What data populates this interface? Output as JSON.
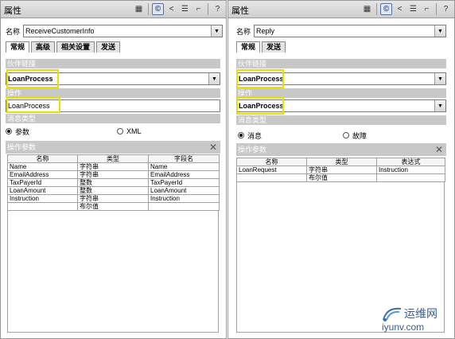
{
  "left_panel": {
    "title": "属性",
    "name_label": "名称",
    "name_value": "ReceiveCustomerInfo",
    "tabs": [
      "常规",
      "高级",
      "相关设置",
      "发送"
    ],
    "partner_link_label": "伙伴链接",
    "partner_link_value": "LoanProcess",
    "operation_label": "操作",
    "operation_value": "LoanProcess",
    "message_type_label": "消息类型",
    "radio_params": "参数",
    "radio_xml": "XML",
    "params_label": "操作参数",
    "columns": [
      "名称",
      "类型",
      "字段名"
    ],
    "rows": [
      [
        "Name",
        "字符串",
        "Name"
      ],
      [
        "EmailAddress",
        "字符串",
        "EmailAddress"
      ],
      [
        "TaxPayerId",
        "整数",
        "TaxPayerId"
      ],
      [
        "LoanAmount",
        "整数",
        "LoanAmount"
      ],
      [
        "Instruction",
        "字符串",
        "Instruction"
      ],
      [
        "",
        "布尔值",
        ""
      ]
    ]
  },
  "right_panel": {
    "title": "属性",
    "name_label": "名称",
    "name_value": "Reply",
    "tabs": [
      "常规",
      "发送"
    ],
    "partner_link_label": "伙伴链接",
    "partner_link_value": "LoanProcess",
    "operation_label": "操作",
    "operation_value": "LoanProcess",
    "message_type_label": "消息类型",
    "radio_message": "消息",
    "radio_fault": "故障",
    "params_label": "操作参数",
    "columns": [
      "名称",
      "类型",
      "表达式"
    ],
    "rows": [
      [
        "LoanRequest",
        "字符串",
        "Instruction"
      ],
      [
        "",
        "布尔值",
        ""
      ]
    ]
  },
  "watermark": {
    "cn": "运维网",
    "en": "iyunv.com"
  }
}
